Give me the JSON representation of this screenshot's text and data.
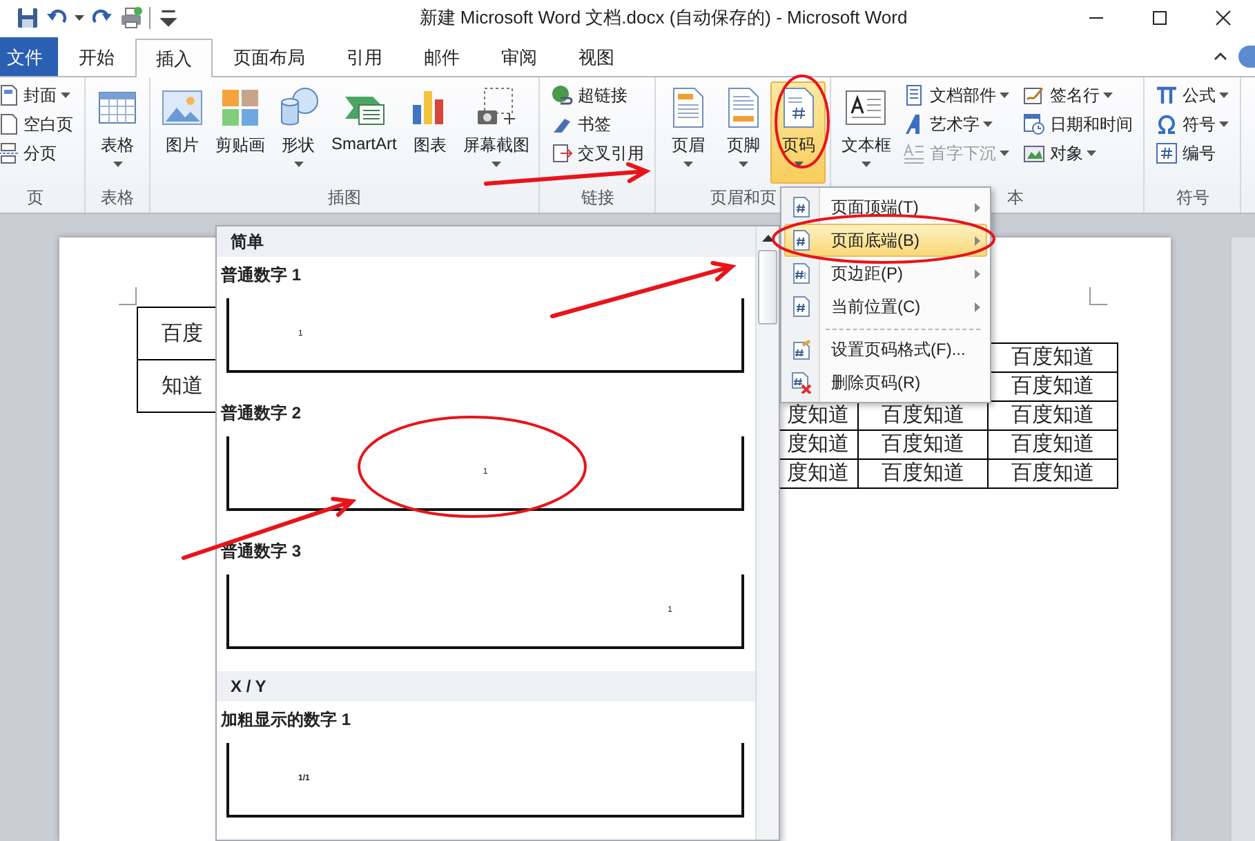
{
  "window": {
    "title": "新建 Microsoft Word 文档.docx (自动保存的)  -  Microsoft Word"
  },
  "tabs": [
    {
      "label": "文件",
      "kind": "file",
      "selected": false
    },
    {
      "label": "开始",
      "kind": "tab",
      "selected": false
    },
    {
      "label": "插入",
      "kind": "tab",
      "selected": true
    },
    {
      "label": "页面布局",
      "kind": "tab",
      "selected": false
    },
    {
      "label": "引用",
      "kind": "tab",
      "selected": false
    },
    {
      "label": "邮件",
      "kind": "tab",
      "selected": false
    },
    {
      "label": "审阅",
      "kind": "tab",
      "selected": false
    },
    {
      "label": "视图",
      "kind": "tab",
      "selected": false
    }
  ],
  "ribbon": {
    "groups": [
      {
        "label": "页",
        "items": [
          {
            "label": "封面",
            "kind": "small",
            "dropdown": true,
            "pressed": false,
            "disabled": false
          },
          {
            "label": "空白页",
            "kind": "small",
            "dropdown": false,
            "pressed": false,
            "disabled": false
          },
          {
            "label": "分页",
            "kind": "small",
            "dropdown": false,
            "pressed": false,
            "disabled": false
          }
        ]
      },
      {
        "label": "表格",
        "items": [
          {
            "label": "表格",
            "kind": "large",
            "dropdown": true,
            "pressed": false,
            "disabled": false
          }
        ]
      },
      {
        "label": "插图",
        "items": [
          {
            "label": "图片",
            "kind": "large",
            "dropdown": false,
            "pressed": false,
            "disabled": false
          },
          {
            "label": "剪贴画",
            "kind": "large",
            "dropdown": false,
            "pressed": false,
            "disabled": false
          },
          {
            "label": "形状",
            "kind": "large",
            "dropdown": true,
            "pressed": false,
            "disabled": false
          },
          {
            "label": "SmartArt",
            "kind": "large",
            "dropdown": false,
            "pressed": false,
            "disabled": false
          },
          {
            "label": "图表",
            "kind": "large",
            "dropdown": false,
            "pressed": false,
            "disabled": false
          },
          {
            "label": "屏幕截图",
            "kind": "large",
            "dropdown": true,
            "pressed": false,
            "disabled": false
          }
        ]
      },
      {
        "label": "链接",
        "items": [
          {
            "label": "超链接",
            "kind": "small",
            "dropdown": false,
            "pressed": false,
            "disabled": false
          },
          {
            "label": "书签",
            "kind": "small",
            "dropdown": false,
            "pressed": false,
            "disabled": false
          },
          {
            "label": "交叉引用",
            "kind": "small",
            "dropdown": false,
            "pressed": false,
            "disabled": false
          }
        ]
      },
      {
        "label": "页眉和页",
        "items": [
          {
            "label": "页眉",
            "kind": "large",
            "dropdown": true,
            "pressed": false,
            "disabled": false
          },
          {
            "label": "页脚",
            "kind": "large",
            "dropdown": true,
            "pressed": false,
            "disabled": false
          },
          {
            "label": "页码",
            "kind": "large",
            "dropdown": true,
            "pressed": true,
            "disabled": false
          }
        ]
      },
      {
        "label": "本",
        "items": [
          {
            "label": "文本框",
            "kind": "large",
            "dropdown": true,
            "pressed": false,
            "disabled": false
          },
          {
            "label": "文档部件",
            "kind": "small",
            "dropdown": true,
            "pressed": false,
            "disabled": false
          },
          {
            "label": "艺术字",
            "kind": "small",
            "dropdown": true,
            "pressed": false,
            "disabled": false
          },
          {
            "label": "首字下沉",
            "kind": "small",
            "dropdown": true,
            "pressed": false,
            "disabled": true
          },
          {
            "label": "签名行",
            "kind": "small",
            "dropdown": true,
            "pressed": false,
            "disabled": false
          },
          {
            "label": "日期和时间",
            "kind": "small",
            "dropdown": false,
            "pressed": false,
            "disabled": false
          },
          {
            "label": "对象",
            "kind": "small",
            "dropdown": true,
            "pressed": false,
            "disabled": false
          }
        ]
      },
      {
        "label": "符号",
        "items": [
          {
            "label": "公式",
            "kind": "small",
            "dropdown": true,
            "pressed": false,
            "disabled": false
          },
          {
            "label": "符号",
            "kind": "small",
            "dropdown": true,
            "pressed": false,
            "disabled": false
          },
          {
            "label": "编号",
            "kind": "small",
            "dropdown": false,
            "pressed": false,
            "disabled": false
          }
        ]
      }
    ]
  },
  "document": {
    "left_table": {
      "rows": [
        "百度",
        "知道"
      ]
    },
    "right_table": {
      "rows": [
        [
          "百度知道"
        ],
        [
          "百度知道"
        ],
        [
          "度知道",
          "百度知道",
          "百度知道"
        ],
        [
          "度知道",
          "百度知道",
          "百度知道"
        ],
        [
          "度知道",
          "百度知道",
          "百度知道"
        ]
      ]
    }
  },
  "gallery": {
    "sections": [
      {
        "title": "简单",
        "items": [
          {
            "name": "普通数字 1",
            "preview": "1",
            "kind": "left",
            "bold": false
          },
          {
            "name": "普通数字 2",
            "preview": "1",
            "kind": "center",
            "bold": false
          },
          {
            "name": "普通数字 3",
            "preview": "1",
            "kind": "right",
            "bold": false
          }
        ]
      },
      {
        "title": "X / Y",
        "items": [
          {
            "name": "加粗显示的数字 1",
            "preview": "1/1",
            "kind": "left",
            "bold": true
          }
        ]
      }
    ]
  },
  "menu": {
    "items": [
      {
        "label": "页面顶端(T)",
        "kind": "position",
        "submenu": true,
        "separated": false,
        "selected": false
      },
      {
        "label": "页面底端(B)",
        "kind": "position",
        "submenu": true,
        "separated": false,
        "selected": true
      },
      {
        "label": "页边距(P)",
        "kind": "margin",
        "submenu": true,
        "separated": false,
        "selected": false
      },
      {
        "label": "当前位置(C)",
        "kind": "position",
        "submenu": true,
        "separated": false,
        "selected": false
      },
      {
        "label": "设置页码格式(F)...",
        "kind": "format",
        "submenu": false,
        "separated": true,
        "selected": false
      },
      {
        "label": "删除页码(R)",
        "kind": "delete",
        "submenu": false,
        "separated": false,
        "selected": false
      }
    ]
  }
}
